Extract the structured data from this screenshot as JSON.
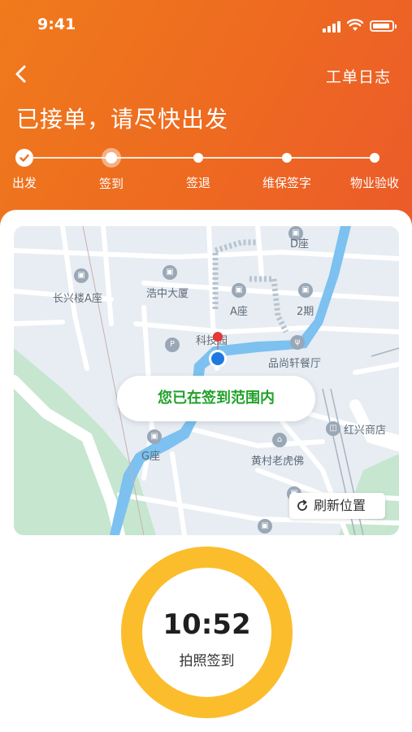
{
  "status_bar": {
    "time": "9:41"
  },
  "header": {
    "log_link": "工单日志",
    "title": "已接单，请尽快出发"
  },
  "steps": [
    {
      "label": "出发",
      "state": "done"
    },
    {
      "label": "签到",
      "state": "current"
    },
    {
      "label": "签退",
      "state": "pending"
    },
    {
      "label": "维保签字",
      "state": "pending"
    },
    {
      "label": "物业验收",
      "state": "pending"
    }
  ],
  "map": {
    "labels": {
      "d_block": "D座",
      "changxing": "长兴楼A座",
      "haozhong": "浩中大厦",
      "a_block": "A座",
      "phase2": "2期",
      "keji": "科技园",
      "pinshang": "品尚轩餐厅",
      "hongxing": "红兴商店",
      "g_block": "G座",
      "huangcun": "黄村老虎佛"
    },
    "range_status": "您已在签到范围内",
    "refresh_label": "刷新位置"
  },
  "checkin": {
    "time": "10:52",
    "label": "拍照签到"
  },
  "colors": {
    "header_gradient_start": "#f07a1c",
    "header_gradient_end": "#ec5a2a",
    "range_text": "#21a12a",
    "ring": "#fbbd2c",
    "map_water": "#7cc1f0",
    "map_green": "#c7e8d0"
  }
}
